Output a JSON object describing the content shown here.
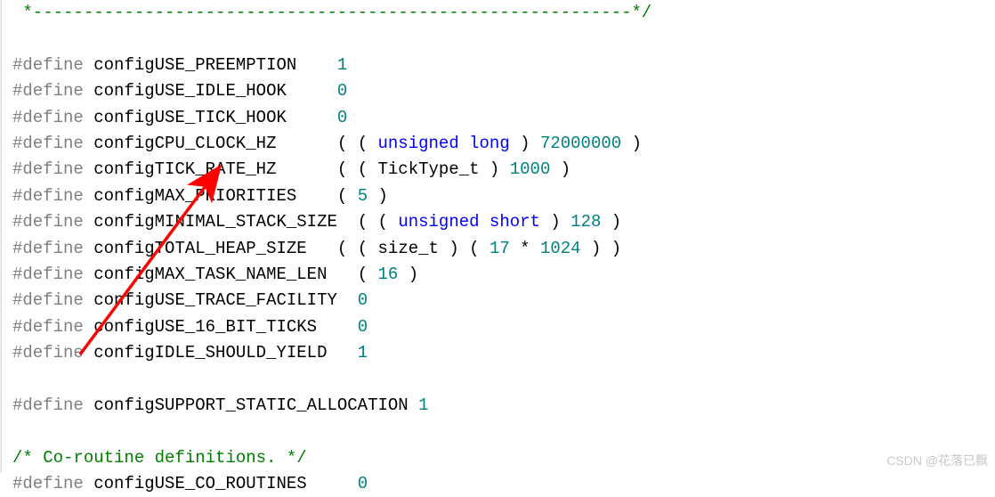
{
  "line1": {
    "comment": " *-----------------------------------------------------------*/"
  },
  "line2": {
    "blank": ""
  },
  "defs": {
    "preemption": {
      "d": "#define",
      "name": "configUSE_PREEMPTION",
      "pad": "    ",
      "val": "1"
    },
    "idle_hook": {
      "d": "#define",
      "name": "configUSE_IDLE_HOOK",
      "pad": "     ",
      "val": "0"
    },
    "tick_hook": {
      "d": "#define",
      "name": "configUSE_TICK_HOOK",
      "pad": "     ",
      "val": "0"
    },
    "cpu_clock": {
      "d": "#define",
      "name": "configCPU_CLOCK_HZ",
      "pad": "      ",
      "o": "( ( ",
      "kw": "unsigned long",
      "mid": " ) ",
      "val": "72000000",
      "c": " )"
    },
    "tick_rate": {
      "d": "#define",
      "name": "configTICK_RATE_HZ",
      "pad": "      ",
      "o": "( ( TickType_t ) ",
      "val": "1000",
      "c": " )"
    },
    "max_prio": {
      "d": "#define",
      "name": "configMAX_PRIORITIES",
      "pad": "    ",
      "o": "( ",
      "val": "5",
      "c": " )"
    },
    "min_stack": {
      "d": "#define",
      "name": "configMINIMAL_STACK_SIZE",
      "pad": "  ",
      "o": "( ( ",
      "kw": "unsigned short",
      "mid": " ) ",
      "val": "128",
      "c": " )"
    },
    "heap": {
      "d": "#define",
      "name": "configTOTAL_HEAP_SIZE",
      "pad": "   ",
      "o": "( ( size_t ) ( ",
      "v1": "17",
      "star": " * ",
      "v2": "1024",
      "c": " ) )"
    },
    "task_name": {
      "d": "#define",
      "name": "configMAX_TASK_NAME_LEN",
      "pad": "   ",
      "o": "( ",
      "val": "16",
      "c": " )"
    },
    "trace": {
      "d": "#define",
      "name": "configUSE_TRACE_FACILITY",
      "pad": "  ",
      "val": "0"
    },
    "bit16": {
      "d": "#define",
      "name": "configUSE_16_BIT_TICKS",
      "pad": "    ",
      "val": "0"
    },
    "idle_yield": {
      "d": "#define",
      "name": "configIDLE_SHOULD_YIELD",
      "pad": "   ",
      "val": "1"
    },
    "static_alloc": {
      "d": "#define",
      "name": "configSUPPORT_STATIC_ALLOCATION ",
      "val": "1"
    },
    "co_routines": {
      "d": "#define",
      "name": "configUSE_CO_ROUTINES",
      "pad": "     ",
      "val": "0"
    }
  },
  "comment_coroutine": "/* Co-routine definitions. */",
  "watermark": "CSDN @花落已飘"
}
